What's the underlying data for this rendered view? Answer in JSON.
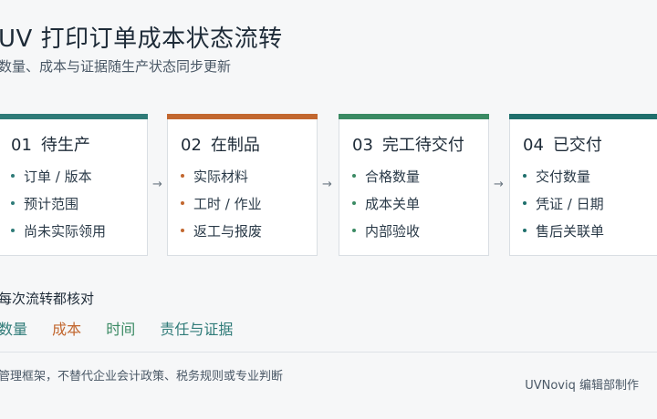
{
  "title": "UV 打印订单成本状态流转",
  "subtitle": "数量、成本与证据随生产状态同步更新",
  "arrow_glyph": "→",
  "steps": [
    {
      "num": "01",
      "label": "待生产",
      "color": "#2f7b78",
      "items": [
        "订单 / 版本",
        "预计范围",
        "尚未实际领用"
      ]
    },
    {
      "num": "02",
      "label": "在制品",
      "color": "#c2672f",
      "items": [
        "实际材料",
        "工时 / 作业",
        "返工与报废"
      ]
    },
    {
      "num": "03",
      "label": "完工待交付",
      "color": "#3a8a63",
      "items": [
        "合格数量",
        "成本关单",
        "内部验收"
      ]
    },
    {
      "num": "04",
      "label": "已交付",
      "color": "#1f6f6c",
      "items": [
        "交付数量",
        "凭证 / 日期",
        "售后关联单"
      ]
    }
  ],
  "check": {
    "label": "每次流转都核对",
    "tags": [
      {
        "text": "数量",
        "color": "#2f7b78"
      },
      {
        "text": "成本",
        "color": "#c2672f"
      },
      {
        "text": "时间",
        "color": "#3a8a63"
      },
      {
        "text": "责任与证据",
        "color": "#2f7b78"
      }
    ]
  },
  "footnote": "管理框架，不替代企业会计政策、税务规则或专业判断",
  "credit": "UVNoviq 编辑部制作"
}
